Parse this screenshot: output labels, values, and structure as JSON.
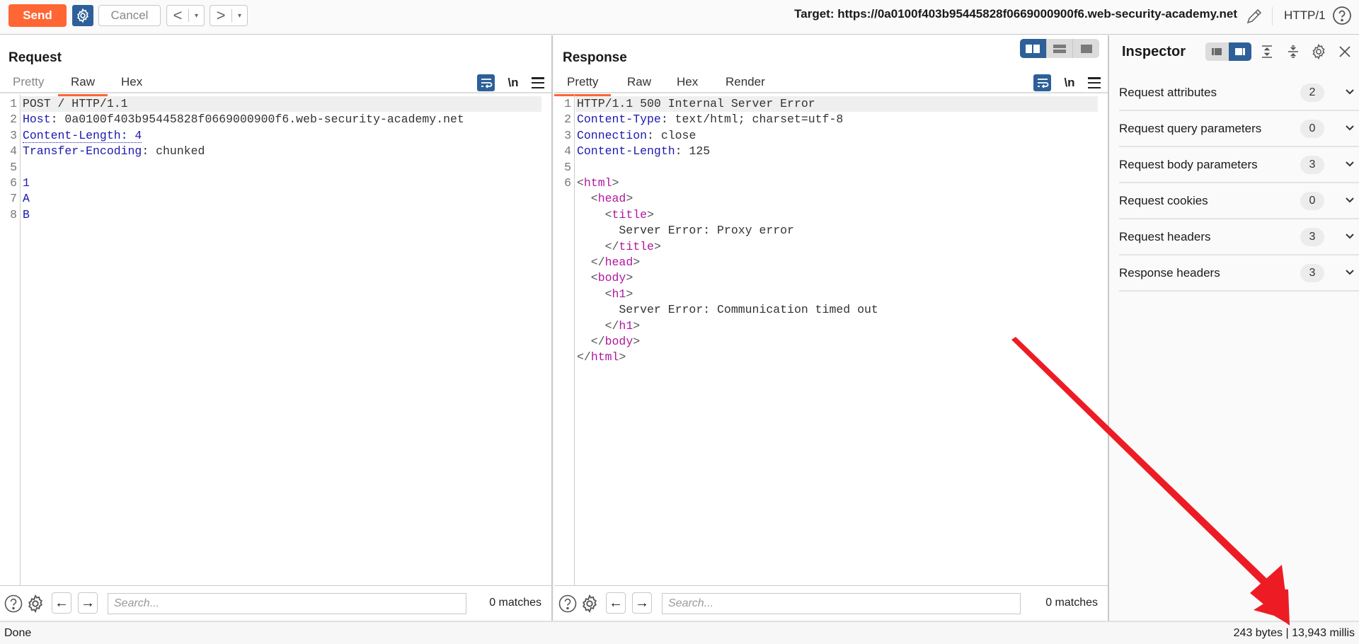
{
  "toolbar": {
    "send_label": "Send",
    "cancel_label": "Cancel",
    "back_glyph": "<",
    "forward_glyph": ">",
    "dropdown_glyph": "▾",
    "target_text": "Target: https://0a0100f403b95445828f0669000900f6.web-security-academy.net",
    "http_version": "HTTP/1",
    "icons": [
      "settings-icon",
      "pencil-icon",
      "help-icon"
    ]
  },
  "request": {
    "title": "Request",
    "tabs": [
      {
        "label": "Pretty",
        "active": false
      },
      {
        "label": "Raw",
        "active": true
      },
      {
        "label": "Hex",
        "active": false
      }
    ],
    "newline_toggle": "\\n",
    "lines": [
      {
        "n": "1",
        "parts": [
          {
            "t": "POST / HTTP/1.1",
            "c": "v"
          }
        ]
      },
      {
        "n": "2",
        "parts": [
          {
            "t": "Host",
            "c": "k"
          },
          {
            "t": ": 0a0100f403b95445828f0669000900f6.web-security-academy.net",
            "c": "v"
          }
        ]
      },
      {
        "n": "3",
        "parts": [
          {
            "t": "Content-Length: 4",
            "c": "k dotted"
          }
        ]
      },
      {
        "n": "4",
        "parts": [
          {
            "t": "Transfer-Encoding",
            "c": "k"
          },
          {
            "t": ": chunked",
            "c": "v"
          }
        ]
      },
      {
        "n": "5",
        "parts": []
      },
      {
        "n": "6",
        "parts": [
          {
            "t": "1",
            "c": "blue"
          }
        ]
      },
      {
        "n": "7",
        "parts": [
          {
            "t": "A",
            "c": "blue"
          }
        ]
      },
      {
        "n": "8",
        "parts": [
          {
            "t": "B",
            "c": "blue"
          }
        ]
      }
    ],
    "search": {
      "placeholder": "Search...",
      "value": "",
      "matches": "0 matches"
    }
  },
  "response": {
    "title": "Response",
    "tabs": [
      {
        "label": "Pretty",
        "active": true
      },
      {
        "label": "Raw",
        "active": false
      },
      {
        "label": "Hex",
        "active": false
      },
      {
        "label": "Render",
        "active": false
      }
    ],
    "newline_toggle": "\\n",
    "lines": [
      {
        "n": "1",
        "parts": [
          {
            "t": "HTTP/1.1 500 Internal Server Error",
            "c": "v"
          }
        ]
      },
      {
        "n": "2",
        "parts": [
          {
            "t": "Content-Type",
            "c": "k"
          },
          {
            "t": ": text/html; charset=utf-8",
            "c": "v"
          }
        ]
      },
      {
        "n": "3",
        "parts": [
          {
            "t": "Connection",
            "c": "k"
          },
          {
            "t": ": close",
            "c": "v"
          }
        ]
      },
      {
        "n": "4",
        "parts": [
          {
            "t": "Content-Length",
            "c": "k"
          },
          {
            "t": ": 125",
            "c": "v"
          }
        ]
      },
      {
        "n": "5",
        "parts": []
      },
      {
        "n": "6",
        "parts": [
          {
            "t": "<",
            "c": "br"
          },
          {
            "t": "html",
            "c": "tag"
          },
          {
            "t": ">",
            "c": "br"
          }
        ]
      },
      {
        "n": "",
        "parts": [
          {
            "t": "  <",
            "c": "br"
          },
          {
            "t": "head",
            "c": "tag"
          },
          {
            "t": ">",
            "c": "br"
          }
        ]
      },
      {
        "n": "",
        "parts": [
          {
            "t": "    <",
            "c": "br"
          },
          {
            "t": "title",
            "c": "tag"
          },
          {
            "t": ">",
            "c": "br"
          }
        ]
      },
      {
        "n": "",
        "parts": [
          {
            "t": "      Server Error: Proxy error",
            "c": "v"
          }
        ]
      },
      {
        "n": "",
        "parts": [
          {
            "t": "    </",
            "c": "br"
          },
          {
            "t": "title",
            "c": "tag"
          },
          {
            "t": ">",
            "c": "br"
          }
        ]
      },
      {
        "n": "",
        "parts": [
          {
            "t": "  </",
            "c": "br"
          },
          {
            "t": "head",
            "c": "tag"
          },
          {
            "t": ">",
            "c": "br"
          }
        ]
      },
      {
        "n": "",
        "parts": [
          {
            "t": "  <",
            "c": "br"
          },
          {
            "t": "body",
            "c": "tag"
          },
          {
            "t": ">",
            "c": "br"
          }
        ]
      },
      {
        "n": "",
        "parts": [
          {
            "t": "    <",
            "c": "br"
          },
          {
            "t": "h1",
            "c": "tag"
          },
          {
            "t": ">",
            "c": "br"
          }
        ]
      },
      {
        "n": "",
        "parts": [
          {
            "t": "      Server Error: Communication timed out",
            "c": "v"
          }
        ]
      },
      {
        "n": "",
        "parts": [
          {
            "t": "    </",
            "c": "br"
          },
          {
            "t": "h1",
            "c": "tag"
          },
          {
            "t": ">",
            "c": "br"
          }
        ]
      },
      {
        "n": "",
        "parts": [
          {
            "t": "  </",
            "c": "br"
          },
          {
            "t": "body",
            "c": "tag"
          },
          {
            "t": ">",
            "c": "br"
          }
        ]
      },
      {
        "n": "",
        "parts": [
          {
            "t": "</",
            "c": "br"
          },
          {
            "t": "html",
            "c": "tag"
          },
          {
            "t": ">",
            "c": "br"
          }
        ]
      }
    ],
    "search": {
      "placeholder": "Search...",
      "value": "",
      "matches": "0 matches"
    }
  },
  "layout_toggle": {
    "options": [
      "side-by-side",
      "stacked",
      "single"
    ],
    "active": "side-by-side"
  },
  "inspector": {
    "title": "Inspector",
    "sections": [
      {
        "label": "Request attributes",
        "count": "2"
      },
      {
        "label": "Request query parameters",
        "count": "0"
      },
      {
        "label": "Request body parameters",
        "count": "3"
      },
      {
        "label": "Request cookies",
        "count": "0"
      },
      {
        "label": "Request headers",
        "count": "3"
      },
      {
        "label": "Response headers",
        "count": "3"
      }
    ]
  },
  "status": {
    "left": "Done",
    "right": "243 bytes | 13,943 millis"
  },
  "colors": {
    "accent": "#ff6633",
    "brand_blue": "#2d6099",
    "header_key": "#1a1ab0",
    "html_tag": "#b0179f",
    "annotation_arrow": "#ed1c24"
  }
}
